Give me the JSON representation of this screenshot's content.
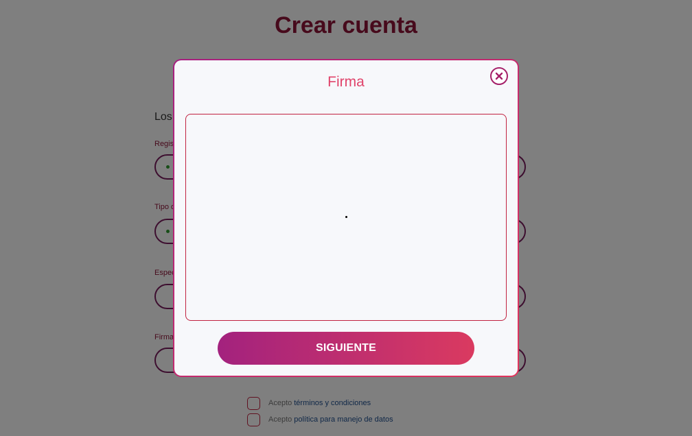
{
  "page": {
    "title": "Crear cuenta",
    "section_heading": "Los",
    "fields": [
      {
        "label": "Regis"
      },
      {
        "label": "Tipo d"
      },
      {
        "label": "Espec"
      },
      {
        "label": "Firma"
      }
    ],
    "consents": [
      {
        "prefix": "Acepto",
        "link": "términos y condiciones"
      },
      {
        "prefix": "Acepto",
        "link": "política para manejo de datos"
      }
    ]
  },
  "modal": {
    "title": "Firma",
    "close_icon": "close-icon",
    "next_label": "SIGUIENTE"
  },
  "colors": {
    "brand": "#8e1538",
    "accent_start": "#a3227e",
    "accent_end": "#da3a60",
    "overlay": "rgba(0,0,0,0.5)"
  }
}
